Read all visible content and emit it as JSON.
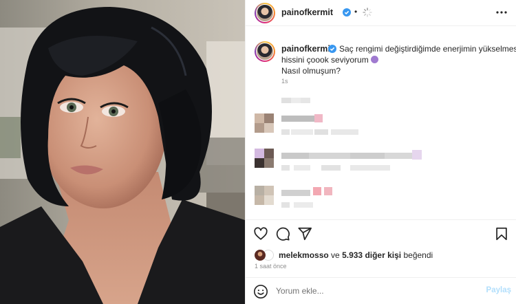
{
  "post": {
    "username": "painofkermit",
    "separator": "•",
    "caption": {
      "line1": "Saç rengimi değiştirdiğimde enerjimin yükselmesi",
      "line2": "hissini çoook seviyorum",
      "line3": "Nasıl olmuşum?",
      "time": "1s"
    },
    "likes": {
      "liker": "melekmosso",
      "connector": "ve",
      "others": "5.933 diğer kişi",
      "suffix": "beğendi"
    },
    "posted": "1 saat önce",
    "comment": {
      "placeholder": "Yorum ekle...",
      "share_label": "Paylaş"
    }
  },
  "icons": {
    "verified": "verified-badge-icon",
    "more": "more-options-icon",
    "like": "heart-icon",
    "comment": "comment-icon",
    "share": "send-icon",
    "save": "bookmark-icon",
    "emoji": "smile-icon"
  },
  "colors": {
    "verified": "#3897f0",
    "link_disabled": "#b2dffc",
    "muted": "#8e8e8e",
    "text": "#262626"
  }
}
